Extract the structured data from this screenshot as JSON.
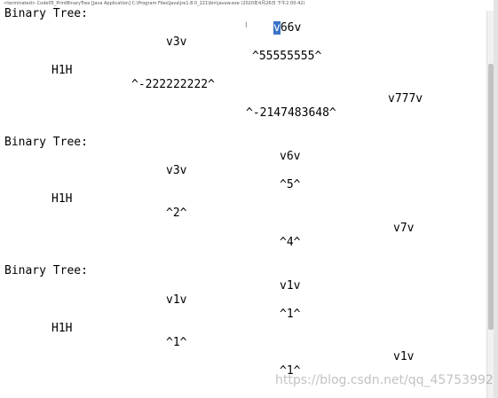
{
  "console": {
    "header": "<terminated> Code05_PrintBinaryTree [Java Application] C:\\Program Files\\Java\\jre1.8.0_221\\bin\\javaw.exe (2020年4月26日 下午2:00:42)",
    "tree1": {
      "title": "Binary Tree:",
      "line_v66v_sel": "v",
      "line_v66v_rest": "66v",
      "line_v3v": "v3v",
      "line_5": "^55555555^",
      "line_h1h": "H1H",
      "line_2": "^-222222222^",
      "line_v777v": "v777v",
      "line_min": "^-2147483648^"
    },
    "tree2": {
      "title": "Binary Tree:",
      "line_v6v": "v6v",
      "line_v3v": "v3v",
      "line_5": "^5^",
      "line_h1h": "H1H",
      "line_2": "^2^",
      "line_v7v": "v7v",
      "line_4": "^4^"
    },
    "tree3": {
      "title": "Binary Tree:",
      "line_a": "v1v",
      "line_b": "v1v",
      "line_c": "^1^",
      "line_h1h": "H1H",
      "line_d": "^1^",
      "line_e": "v1v",
      "line_f": "^1^"
    },
    "cursor_glyph": "I",
    "watermark": "https://blog.csdn.net/qq_45753992"
  }
}
